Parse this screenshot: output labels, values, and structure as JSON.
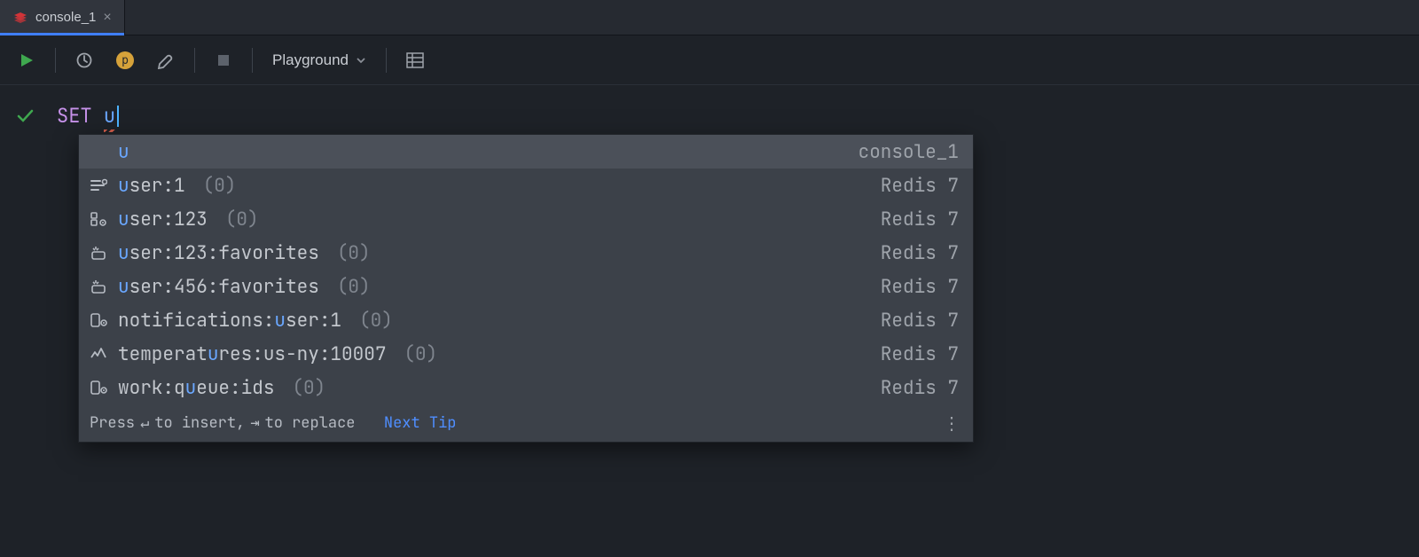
{
  "tab": {
    "label": "console_1"
  },
  "toolbar": {
    "dropdown_label": "Playground"
  },
  "code": {
    "keyword": "SET",
    "typed": "u"
  },
  "popup": {
    "items": [
      {
        "icon": "",
        "pre": "",
        "hi": "u",
        "post": "",
        "meta": "",
        "src": "console_1",
        "selected": true
      },
      {
        "icon": "string",
        "pre": "",
        "hi": "u",
        "post": "ser:1",
        "meta": "(0)",
        "src": "Redis 7"
      },
      {
        "icon": "hash",
        "pre": "",
        "hi": "u",
        "post": "ser:123",
        "meta": "(0)",
        "src": "Redis 7"
      },
      {
        "icon": "set",
        "pre": "",
        "hi": "u",
        "post": "ser:123:favorites",
        "meta": "(0)",
        "src": "Redis 7"
      },
      {
        "icon": "set",
        "pre": "",
        "hi": "u",
        "post": "ser:456:favorites",
        "meta": "(0)",
        "src": "Redis 7"
      },
      {
        "icon": "list",
        "pre": "notifications:",
        "hi": "u",
        "post": "ser:1",
        "meta": "(0)",
        "src": "Redis 7"
      },
      {
        "icon": "ts",
        "pre": "temperat",
        "hi": "u",
        "post": "res:us-ny:10007",
        "meta": "(0)",
        "src": "Redis 7"
      },
      {
        "icon": "list",
        "pre": "work:q",
        "hi": "u",
        "post": "eue:ids",
        "meta": "(0)",
        "src": "Redis 7"
      }
    ],
    "footer": {
      "press": "Press",
      "to_insert": "to insert,",
      "to_replace": "to replace",
      "next_tip": "Next Tip"
    }
  }
}
